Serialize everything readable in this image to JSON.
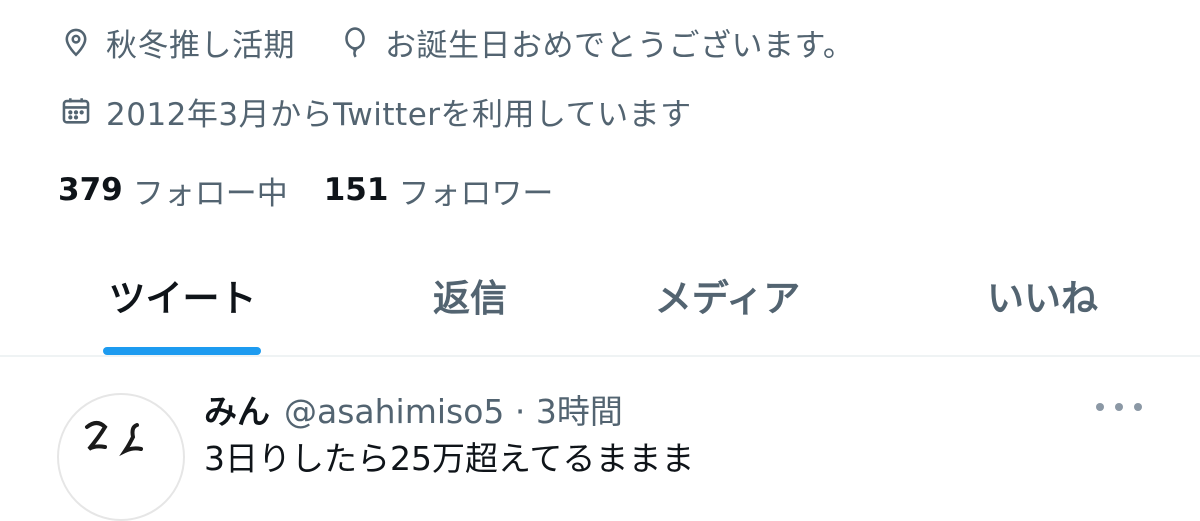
{
  "profile": {
    "location": "秋冬推し活期",
    "birthday": "お誕生日おめでとうございます。",
    "joined": "2012年3月からTwitterを利用しています",
    "following_count": "379",
    "following_label": "フォロー中",
    "followers_count": "151",
    "followers_label": "フォロワー"
  },
  "tabs": [
    {
      "label": "ツイート",
      "active": true
    },
    {
      "label": "返信",
      "active": false
    },
    {
      "label": "メディア",
      "active": false
    },
    {
      "label": "いいね",
      "active": false
    }
  ],
  "tweet": {
    "name": "みん",
    "handle_time": "@asahimiso5 · 3時間",
    "text": "3日りしたら25万超えてるままま"
  },
  "colors": {
    "accent": "#1d9bf0",
    "secondary_text": "#536471",
    "primary_text": "#0f1419"
  },
  "icons": [
    "location-icon",
    "balloon-icon",
    "calendar-icon",
    "more-icon"
  ]
}
